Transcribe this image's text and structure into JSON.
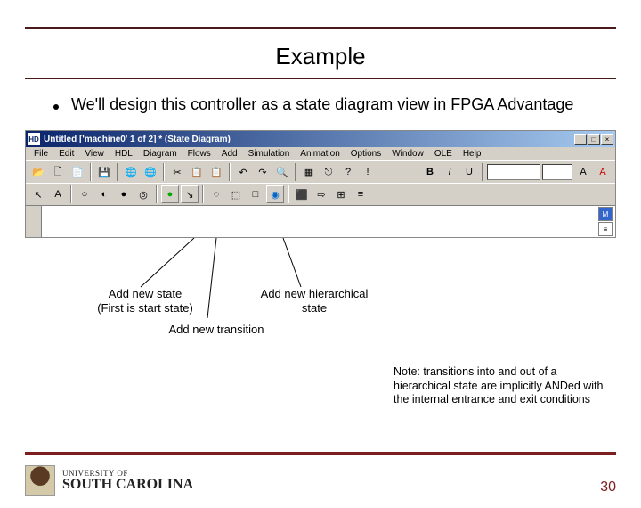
{
  "slide": {
    "title": "Example",
    "bullet": "We'll design this controller as a state diagram view in FPGA Advantage"
  },
  "app": {
    "title": "Untitled ['machine0' 1 of 2] * (State Diagram)",
    "menus": [
      "File",
      "Edit",
      "View",
      "HDL",
      "Diagram",
      "Flows",
      "Add",
      "Simulation",
      "Animation",
      "Options",
      "Window",
      "OLE",
      "Help"
    ],
    "tb1": {
      "open": "📂",
      "new": "🗋",
      "newdoc": "📄",
      "save": "💾",
      "globe1": "🌐",
      "globe2": "🌐",
      "cut": "✂",
      "copy": "📋",
      "paste": "📋",
      "undo": "↶",
      "redo": "↷",
      "find": "🔍",
      "grid": "▦",
      "nav": "⎋",
      "help": "?",
      "ex": "!"
    },
    "tb2": {
      "arrow": "↖",
      "text": "A",
      "st1": "○",
      "st2": "◐",
      "st3": "●",
      "st4": "◎",
      "trans": "↘",
      "hstate": "◉",
      "junc": "◌",
      "ex1": "⬚",
      "ex2": "□",
      "ex3": "⬛",
      "link": "⇨",
      "hier": "⊞",
      "misc": "≡",
      "bold": "B",
      "italic": "I",
      "under": "U",
      "font": "",
      "size": "",
      "fontstyle": "A"
    },
    "palette": {
      "p1": "M",
      "p2": "≡"
    }
  },
  "annotations": {
    "add_state": "Add new state\n(First is start state)",
    "add_transition": "Add new transition",
    "add_hier": "Add new hierarchical\nstate",
    "note": "Note:  transitions into and out of a hierarchical state are implicitly ANDed with the internal entrance and exit conditions"
  },
  "footer": {
    "univ_small": "UNIVERSITY OF",
    "univ_big": "SOUTH CAROLINA",
    "page": "30"
  }
}
